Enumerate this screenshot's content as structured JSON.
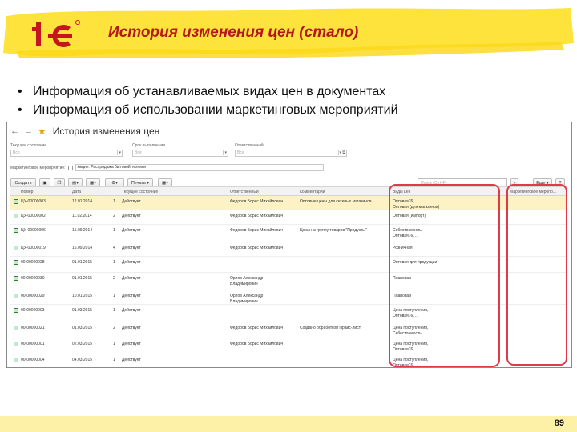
{
  "slide": {
    "title": "История изменения цен (стало)",
    "bullets": [
      "Информация об устанавливаемых видах цен в документах",
      "Информация об использовании маркетинговых мероприятий"
    ],
    "page_number": "89",
    "brush_color": "#fde33c",
    "accent_color": "#b5181c"
  },
  "window": {
    "title": "История изменения цен",
    "nav_back": "←",
    "nav_forward": "→",
    "favorite_icon": "star-icon",
    "filters": {
      "current_state_label": "Текущее состояние",
      "current_state_placeholder": "Все",
      "deadline_label": "Срок выполнения",
      "deadline_placeholder": "Все",
      "responsible_label": "Ответственный",
      "responsible_placeholder": "Все",
      "marketing_label": "Маркетинговое мероприятие:",
      "marketing_value": "Акция: Распродажа бытовой техники"
    },
    "toolbar": {
      "create_label": "Создать",
      "print_label": "Печать",
      "search_placeholder": "Поиск (Ctrl+F)",
      "more_label": "Еще",
      "help_label": "?"
    },
    "columns": [
      "Номер",
      "Дата",
      "Текущее состояние",
      "Ответственный",
      "Комментарий",
      "Виды цен",
      "Маркетинговое меропр..."
    ],
    "rows": [
      {
        "number": "ЦУ-00000003",
        "date": "12.01.2014",
        "n": "1",
        "state": "Действует",
        "responsible": "Федоров Борис Михайлович",
        "comment": "Оптовые цены для сетевых магазинов",
        "price_types": "Оптовая76,\nОптовая (для магазинов)",
        "marketing": ""
      },
      {
        "number": "ЦУ-00000002",
        "date": "11.02.2014",
        "n": "2",
        "state": "Действует",
        "responsible": "Федоров Борис Михайлович",
        "comment": "",
        "price_types": "Оптовая (импорт)",
        "marketing": ""
      },
      {
        "number": "ЦУ-00000006",
        "date": "15.09.2014",
        "n": "1",
        "state": "Действует",
        "responsible": "Федоров Борис Михайлович",
        "comment": "Цены на группу товаров \"Продукты\"",
        "price_types": "Себестоимость,\nОптовая76, ...",
        "marketing": ""
      },
      {
        "number": "ЦУ-00000019",
        "date": "16.09.2014",
        "n": "4",
        "state": "Действует",
        "responsible": "Федоров Борис Михайлович",
        "comment": "",
        "price_types": "Розничная",
        "marketing": ""
      },
      {
        "number": "00-00000028",
        "date": "01.01.2015",
        "n": "1",
        "state": "Действует",
        "responsible": "",
        "comment": "",
        "price_types": "Оптовая для продукции",
        "marketing": ""
      },
      {
        "number": "00-00000030",
        "date": "01.01.2015",
        "n": "2",
        "state": "Действует",
        "responsible": "Орлов Александр\nВладимирович",
        "comment": "",
        "price_types": "Плановая",
        "marketing": ""
      },
      {
        "number": "00-00000029",
        "date": "10.01.2015",
        "n": "1",
        "state": "Действует",
        "responsible": "Орлов Александр\nВладимирович",
        "comment": "",
        "price_types": "Плановая",
        "marketing": ""
      },
      {
        "number": "00-00000003",
        "date": "01.03.2015",
        "n": "1",
        "state": "Действует",
        "responsible": "",
        "comment": "",
        "price_types": "Цена поступления,\nОптовая76, ...",
        "marketing": ""
      },
      {
        "number": "00-00000021",
        "date": "01.03.2015",
        "n": "2",
        "state": "Действует",
        "responsible": "Федоров Борис Михайлович",
        "comment": "Создано обработкой Прайс-лист",
        "price_types": "Цена поступления,\nСебестоимость, ...",
        "marketing": ""
      },
      {
        "number": "00-00000001",
        "date": "02.03.2015",
        "n": "1",
        "state": "Действует",
        "responsible": "Федоров Борис Михайлович",
        "comment": "",
        "price_types": "Цена поступления,\nОптовая76, ...",
        "marketing": ""
      },
      {
        "number": "00-00000004",
        "date": "04.03.2015",
        "n": "1",
        "state": "Действует",
        "responsible": "",
        "comment": "",
        "price_types": "Цена поступления,\nОптовая76, ...",
        "marketing": ""
      }
    ]
  }
}
